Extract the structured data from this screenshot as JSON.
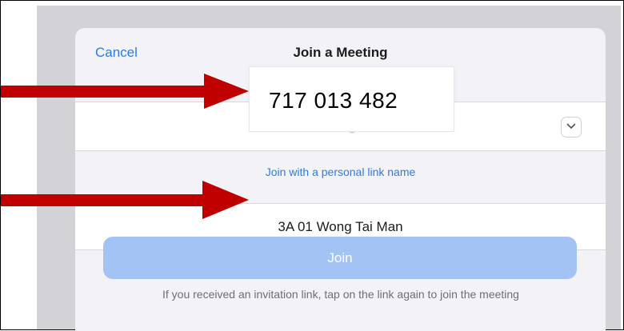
{
  "header": {
    "cancel_label": "Cancel",
    "title": "Join a Meeting"
  },
  "meeting_id": {
    "placeholder": "Meeting ID",
    "value": "717 013 482",
    "dropdown_icon": "chevron-down-icon"
  },
  "personal_link_label": "Join with a personal link name",
  "display_name": "3A 01 Wong Tai Man",
  "join_label": "Join",
  "hint_text": "If you received an invitation link, tap on the link again to join the meeting",
  "annotations": {
    "arrow_color": "#c00000",
    "arrow_icon": "arrow-right-icon"
  },
  "colors": {
    "accent": "#2f7be5",
    "join_disabled": "#a3c3f4",
    "sheet_bg": "#f2f2f7",
    "backdrop": "#d2d2d7"
  }
}
